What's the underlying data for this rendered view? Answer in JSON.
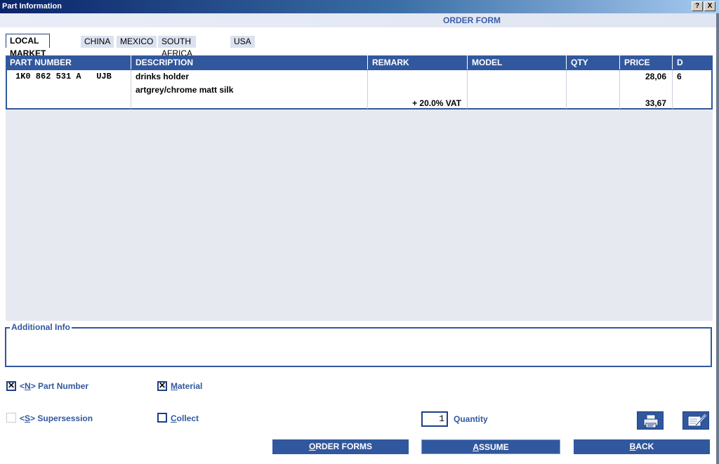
{
  "window": {
    "title": "Part Information",
    "help_label": "?",
    "close_label": "X"
  },
  "form": {
    "title": "ORDER FORM"
  },
  "tabs": [
    {
      "label": "LOCAL MARKET",
      "active": true
    },
    {
      "label": "CHINA",
      "active": false
    },
    {
      "label": "MEXICO",
      "active": false
    },
    {
      "label": "SOUTH AFRICA",
      "active": false
    },
    {
      "label": "USA",
      "active": false
    }
  ],
  "table": {
    "columns": [
      "PART NUMBER",
      "DESCRIPTION",
      "REMARK",
      "MODEL",
      "QTY",
      "PRICE",
      "D"
    ],
    "rows": [
      {
        "part_number": "1K0 862 531 A   UJB",
        "description_line1": "drinks holder",
        "description_line2": "artgrey/chrome matt silk",
        "remark": "+ 20.0% VAT",
        "model": "",
        "qty": "",
        "price_net": "28,06",
        "price_gross": "33,67",
        "d": "6"
      }
    ]
  },
  "additional_info": {
    "legend": "Additional Info",
    "value": ""
  },
  "options": {
    "part_number": {
      "prefix": "<",
      "key": "N",
      "suffix": "> Part Number",
      "checked": true
    },
    "material": {
      "key": "M",
      "rest": "aterial",
      "checked": true
    },
    "supersession": {
      "prefix": "<",
      "key": "S",
      "suffix": "> Supersession",
      "checked": false,
      "enabled": false
    },
    "collect": {
      "key": "C",
      "rest": "ollect",
      "checked": false
    }
  },
  "quantity": {
    "value": "1",
    "label": "Quantity"
  },
  "icons": {
    "print": "printer-icon",
    "edit": "notepad-edit-icon"
  },
  "buttons": {
    "order_forms": {
      "key": "O",
      "rest": "RDER FORMS"
    },
    "assume": {
      "key": "A",
      "rest": "SSUME"
    },
    "back": {
      "key": "B",
      "rest": "ACK"
    }
  },
  "colors": {
    "accent": "#31589e",
    "title_start": "#0a246a",
    "header_bg": "#e9edf6",
    "grid_bg": "#e6e9f0"
  }
}
